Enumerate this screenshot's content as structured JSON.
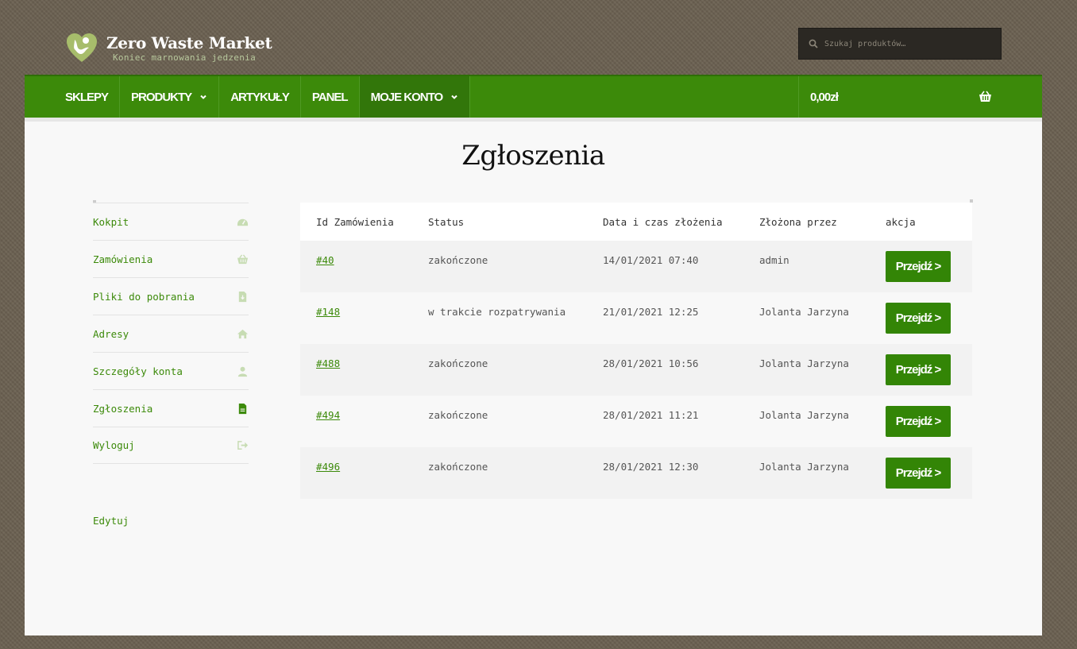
{
  "site": {
    "title": "Zero Waste Market",
    "tagline": "Koniec marnowania jedzenia"
  },
  "search": {
    "placeholder": "Szukaj produktów…"
  },
  "nav": {
    "items": [
      {
        "label": "SKLEPY"
      },
      {
        "label": "PRODUKTY"
      },
      {
        "label": "ARTYKUŁY"
      },
      {
        "label": "PANEL"
      },
      {
        "label": "MOJE KONTO"
      }
    ],
    "cart_total": "0,00zł"
  },
  "page": {
    "title": "Zgłoszenia"
  },
  "sidebar": {
    "items": [
      {
        "label": "Kokpit",
        "icon": "dashboard-icon"
      },
      {
        "label": "Zamówienia",
        "icon": "basket-icon"
      },
      {
        "label": "Pliki do pobrania",
        "icon": "file-download-icon"
      },
      {
        "label": "Adresy",
        "icon": "home-icon"
      },
      {
        "label": "Szczegóły konta",
        "icon": "user-icon"
      },
      {
        "label": "Zgłoszenia",
        "icon": "file-text-icon"
      },
      {
        "label": "Wyloguj",
        "icon": "sign-out-icon"
      }
    ],
    "edit_label": "Edytuj"
  },
  "table": {
    "headers": [
      "Id Zamówienia",
      "Status",
      "Data i czas złożenia",
      "Złożona przez",
      "akcja"
    ],
    "rows": [
      {
        "id": "#40",
        "status": "zakończone",
        "date": "14/01/2021 07:40",
        "by": "admin",
        "action": "Przejdź >"
      },
      {
        "id": "#148",
        "status": "w trakcie rozpatrywania",
        "date": "21/01/2021 12:25",
        "by": "Jolanta Jarzyna",
        "action": "Przejdź >"
      },
      {
        "id": "#488",
        "status": "zakończone",
        "date": "28/01/2021 10:56",
        "by": "Jolanta Jarzyna",
        "action": "Przejdź >"
      },
      {
        "id": "#494",
        "status": "zakończone",
        "date": "28/01/2021 11:21",
        "by": "Jolanta Jarzyna",
        "action": "Przejdź >"
      },
      {
        "id": "#496",
        "status": "zakończone",
        "date": "28/01/2021 12:30",
        "by": "Jolanta Jarzyna",
        "action": "Przejdź >"
      }
    ]
  },
  "colors": {
    "nav_green": "#3c8a0a",
    "button_green": "#338506",
    "link_green": "#3c8a0a",
    "background": "#6b6152",
    "content_bg": "#f8f8f8"
  }
}
